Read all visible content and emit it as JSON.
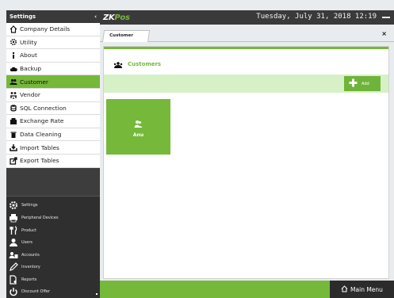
{
  "app": {
    "logo_zk": "ZK",
    "logo_pos": "Pos",
    "datetime": "Tuesday, July 31, 2018 12:19"
  },
  "sidebar": {
    "title": "Settings",
    "collapse_glyph": "‹",
    "items": [
      {
        "label": "Company Details",
        "icon": "home-icon"
      },
      {
        "label": "Utility",
        "icon": "gear-icon"
      },
      {
        "label": "About",
        "icon": "info-icon"
      },
      {
        "label": "Backup",
        "icon": "cloud-icon"
      },
      {
        "label": "Customer",
        "icon": "users-icon",
        "active": true
      },
      {
        "label": "Vendor",
        "icon": "vendor-icon"
      },
      {
        "label": "SQL Connection",
        "icon": "database-icon"
      },
      {
        "label": "Exchange Rate",
        "icon": "exchange-icon"
      },
      {
        "label": "Data Cleaning",
        "icon": "trash-icon"
      },
      {
        "label": "Import Tables",
        "icon": "import-icon"
      },
      {
        "label": "Export Tables",
        "icon": "export-icon"
      }
    ],
    "modules": [
      {
        "label": "Settings",
        "icon": "settings-icon"
      },
      {
        "label": "Peripheral Devices",
        "icon": "printer-icon"
      },
      {
        "label": "Product",
        "icon": "cutlery-icon"
      },
      {
        "label": "Users",
        "icon": "user-icon"
      },
      {
        "label": "Accounts",
        "icon": "accounts-icon"
      },
      {
        "label": "Inventory",
        "icon": "pencil-icon"
      },
      {
        "label": "Reports",
        "icon": "report-icon"
      },
      {
        "label": "Discount Offer",
        "icon": "power-icon"
      }
    ]
  },
  "tab": {
    "label": "Customer",
    "close": "×"
  },
  "content": {
    "heading": "Customers",
    "add_label": "Add",
    "customers": [
      {
        "name": "Anu"
      }
    ]
  },
  "footer": {
    "main_menu_label": "Main Menu"
  },
  "colors": {
    "accent": "#76b83a",
    "dark": "#3a3a3a",
    "strip": "#d7f1c6"
  }
}
